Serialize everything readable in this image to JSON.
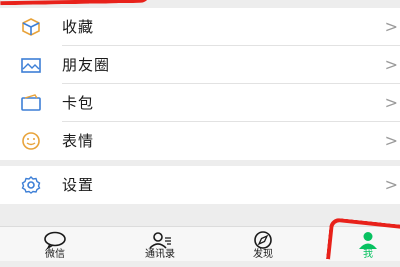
{
  "menu": {
    "items": [
      {
        "label": "收藏",
        "icon": "cube-icon"
      },
      {
        "label": "朋友圈",
        "icon": "picture-icon"
      },
      {
        "label": "卡包",
        "icon": "card-icon"
      },
      {
        "label": "表情",
        "icon": "smiley-icon"
      }
    ],
    "settings": {
      "label": "设置",
      "icon": "gear-icon"
    },
    "chevron": ">"
  },
  "tabbar": {
    "tabs": [
      {
        "label": "微信",
        "icon": "chat-bubble-icon"
      },
      {
        "label": "通讯录",
        "icon": "contacts-icon"
      },
      {
        "label": "发现",
        "icon": "compass-icon"
      },
      {
        "label": "我",
        "icon": "person-icon",
        "active": true
      }
    ]
  },
  "colors": {
    "accent": "#07c160",
    "highlight_annotation": "#e8211a"
  }
}
